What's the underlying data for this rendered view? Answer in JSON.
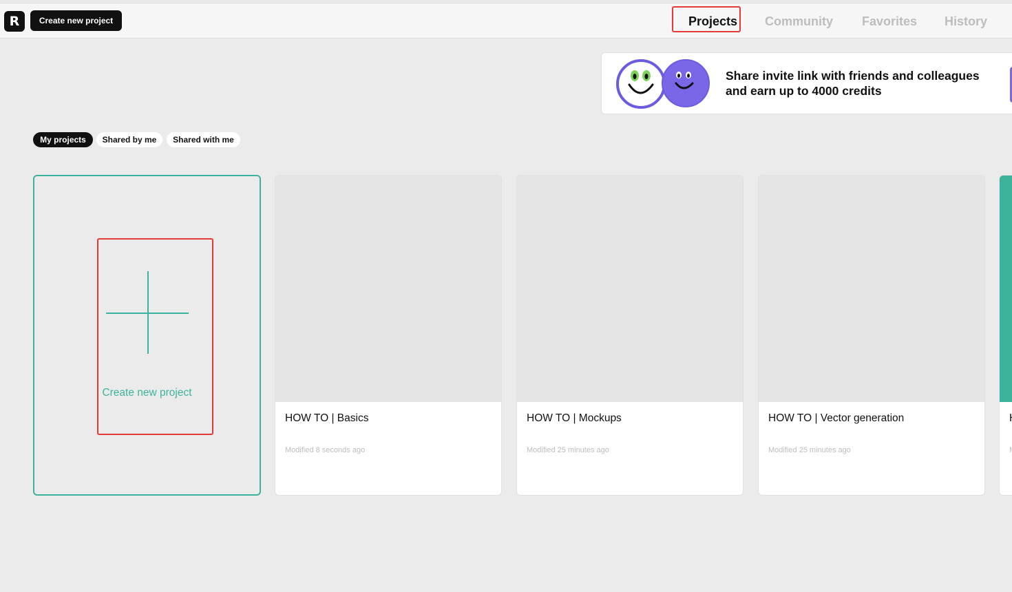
{
  "header": {
    "logo_text": "R",
    "create_button_label": "Create new project",
    "tabs": [
      {
        "label": "Projects",
        "active": true
      },
      {
        "label": "Community",
        "active": false
      },
      {
        "label": "Favorites",
        "active": false
      },
      {
        "label": "History",
        "active": false
      }
    ]
  },
  "banner": {
    "text": "Share invite link with friends and colleagues and earn up to 4000 credits"
  },
  "filters": [
    {
      "label": "My projects",
      "active": true
    },
    {
      "label": "Shared by me",
      "active": false
    },
    {
      "label": "Shared with me",
      "active": false
    }
  ],
  "new_project_card": {
    "label": "Create new project",
    "icon": "plus-icon"
  },
  "projects": [
    {
      "title": "HOW TO | Basics",
      "modified": "Modified 8 seconds ago"
    },
    {
      "title": "HOW TO | Mockups",
      "modified": "Modified 25 minutes ago"
    },
    {
      "title": "HOW TO | Vector generation",
      "modified": "Modified 25 minutes ago"
    },
    {
      "title": "H",
      "modified": "M"
    }
  ],
  "colors": {
    "accent": "#3bb39b",
    "highlight": "#e53935",
    "banner_purple": "#7a67e8"
  }
}
